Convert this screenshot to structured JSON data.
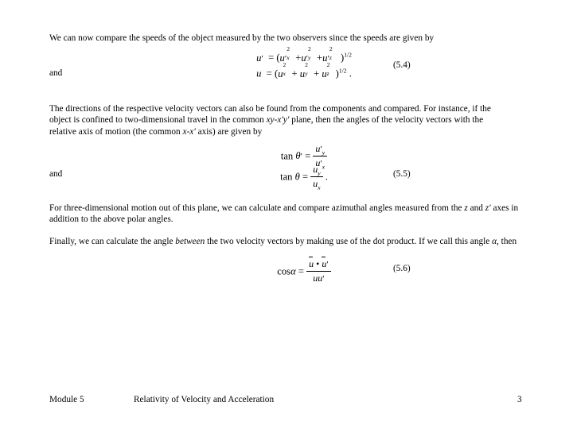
{
  "document": {
    "paragraphs": {
      "intro": "We can now compare the speeds of the object measured by the two observers since the speeds are given by",
      "directions_line1": "The directions of the respective velocity vectors can also be found from the components and compared.  For instance, if the",
      "directions_line2a": "object is confined to two-dimensional travel in the common ",
      "directions_line2b": "xy-x′y′",
      "directions_line2c": " plane, then the angles of the velocity vectors with the",
      "directions_line3a": "relative axis of motion (the common ",
      "directions_line3b": "x-x′",
      "directions_line3c": " axis) are given by",
      "three_dim_a": "For three-dimensional motion out of this plane, we can calculate and compare azimuthal angles measured from the  ",
      "three_dim_b": "z",
      "three_dim_c": " and ",
      "three_dim_d": "z′",
      "three_dim_e": " axes in addition to the above polar angles.",
      "finally_a": "Finally, we can calculate the angle ",
      "finally_b": "between",
      "finally_c": " the two velocity vectors by making use of the dot product.  If we call this angle ",
      "finally_d": "α",
      "finally_e": ", then"
    },
    "connectors": {
      "and_1": "and",
      "and_2": "and"
    },
    "equation_numbers": {
      "eq54": "(5.4)",
      "eq55": "(5.5)",
      "eq56": "(5.6)"
    },
    "equations": {
      "speed_primed": {
        "lhs": "u′",
        "relation": "=",
        "rhs": "(u′x² + u′y² + u′z²)^(1/2)"
      },
      "speed_unprimed": {
        "lhs": "u",
        "relation": "=",
        "rhs": "(ux² + uy² + uz²)^(1/2)",
        "trailing": "."
      },
      "tan_primed": {
        "lhs": "tan θ′",
        "relation": "=",
        "numerator": "u′y",
        "denominator": "u′x"
      },
      "tan_unprimed": {
        "lhs": "tan θ",
        "relation": "=",
        "numerator": "uy",
        "denominator": "ux",
        "trailing": "."
      },
      "cos_alpha": {
        "lhs": "cos α",
        "relation": "=",
        "numerator": "ū • ū′",
        "denominator": "uu′"
      }
    },
    "symbols": {
      "u": "u",
      "prime": "′",
      "theta": "θ",
      "alpha": "α",
      "tan": "tan",
      "cos": "cos",
      "dot": "•",
      "exp_two": "2",
      "exp_half": "1/2",
      "sub_x": "x",
      "sub_y": "y",
      "sub_z": "z",
      "lparen": "(",
      "rparen": ")",
      "plus": "+",
      "equals": "=",
      "period": "."
    }
  },
  "footer": {
    "module": "Module 5",
    "title": "Relativity of Velocity and Acceleration",
    "page_number": "3"
  },
  "colors": {
    "text": "#000000",
    "background": "#ffffff"
  }
}
